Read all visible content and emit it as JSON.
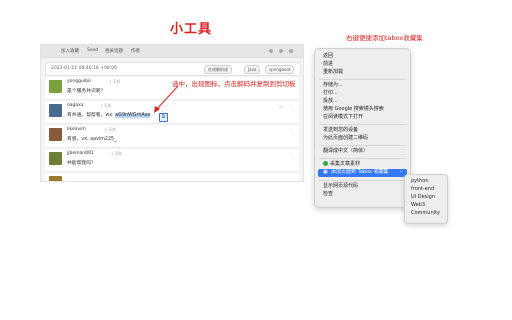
{
  "title": "小工具",
  "right_hint": "右键便捷添加tabox收藏集",
  "annotation": "选中，出现图标，点击解码并复制到剪切板",
  "page": {
    "nav": [
      "加入收藏",
      "Seed",
      "相关话题",
      "作者"
    ],
    "meta": {
      "date": "2023-01-22 08:46:16 +08:00",
      "tags": [
        "在线解析成",
        "Java",
        "springboot"
      ]
    },
    "posts": [
      {
        "user": "yongguibo",
        "ago": "1 天前",
        "text": "是个服务共识呢？",
        "selected": ""
      },
      {
        "user": "oagaxa",
        "ago": "1 天前",
        "text": "有共通。帮帮看。wx: ",
        "selected": "aG9nWGrhAav"
      },
      {
        "user": "likeavim",
        "ago": "1 天前",
        "text": "有感，vx: aavim225_",
        "selected": ""
      },
      {
        "user": "jjbeman001",
        "ago": "1 天前",
        "text": "共能帮我吗？",
        "selected": ""
      },
      {
        "user": "",
        "ago": "",
        "text": "",
        "selected": ""
      }
    ]
  },
  "context_menu": {
    "items": [
      "返回",
      "前进",
      "重新加载",
      "---",
      "存储为...",
      "打印...",
      "投放...",
      "使用 Google 搜索镜头搜索",
      "在阅读模式下打开",
      "---",
      "发送到您的设备",
      "为此页面创建二维码",
      "---",
      "翻译成中文（简体）",
      "---",
      "采集文章素材",
      "添加页面到 Tabox 收藏集",
      "---",
      "显示网页源代码",
      "检查"
    ],
    "highlighted": "添加页面到 Tabox 收藏集",
    "submenu_arrow": "›"
  },
  "submenu": [
    "python",
    "front-end",
    "UI Design",
    "Web3",
    "Community"
  ],
  "colors": {
    "accent_red": "#e02020",
    "highlight_blue": "#3478f6"
  }
}
